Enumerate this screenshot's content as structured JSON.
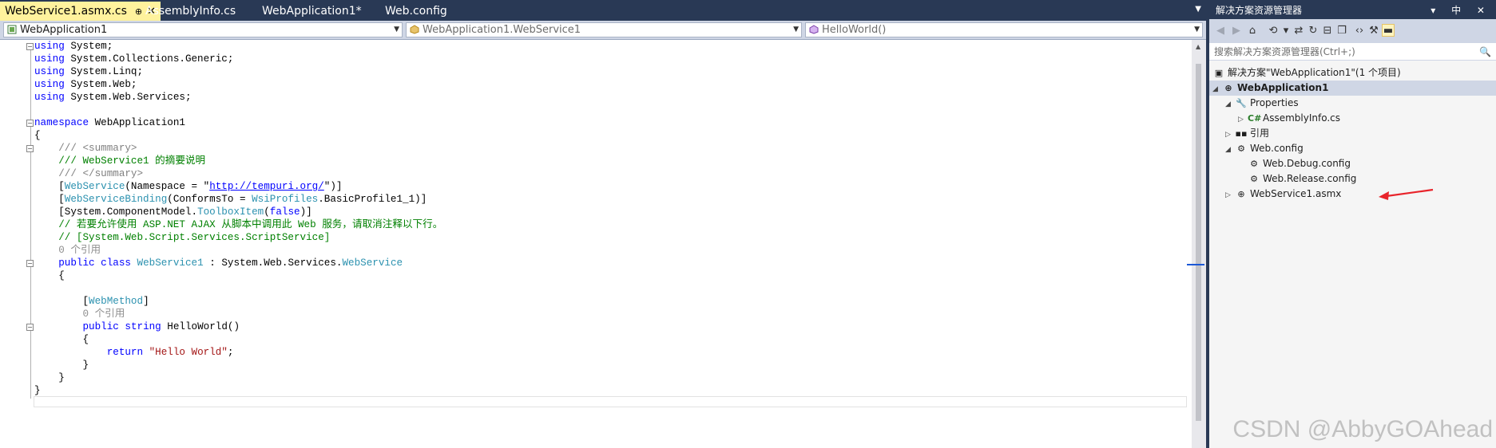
{
  "tabs": [
    {
      "label": "WebService1.asmx.cs",
      "active": true,
      "pin": "⊕",
      "close": "✕"
    },
    {
      "label": "AssemblyInfo.cs",
      "active": false
    },
    {
      "label": "WebApplication1*",
      "active": false
    },
    {
      "label": "Web.config",
      "active": false
    }
  ],
  "navbar": {
    "project": "WebApplication1",
    "class": "WebApplication1.WebService1",
    "member": "HelloWorld()"
  },
  "code": {
    "l1": [
      "using",
      " System;"
    ],
    "l2": [
      "using",
      " System.Collections.Generic;"
    ],
    "l3": [
      "using",
      " System.Linq;"
    ],
    "l4": [
      "using",
      " System.Web;"
    ],
    "l5": [
      "using",
      " System.Web.Services;"
    ],
    "l7": [
      "namespace",
      " WebApplication1"
    ],
    "l8": "{",
    "l9": [
      "    /// ",
      "<summary>"
    ],
    "l10": "    /// WebService1 的摘要说明",
    "l11": [
      "    /// ",
      "</summary>"
    ],
    "l12": [
      "    [",
      "WebService",
      "(Namespace = \"",
      "http://tempuri.org/",
      "\")]"
    ],
    "l13": [
      "    [",
      "WebServiceBinding",
      "(ConformsTo = ",
      "WsiProfiles",
      ".BasicProfile1_1)]"
    ],
    "l14": [
      "    [System.ComponentModel.",
      "ToolboxItem",
      "(",
      "false",
      ")]"
    ],
    "l15": "    // 若要允许使用 ASP.NET AJAX 从脚本中调用此 Web 服务，请取消注释以下行。",
    "l16": "    // [System.Web.Script.Services.ScriptService]",
    "l17": "    0 个引用",
    "l18": [
      "    ",
      "public",
      " ",
      "class",
      " ",
      "WebService1",
      " : System.Web.Services.",
      "WebService"
    ],
    "l19": "    {",
    "l21": [
      "        [",
      "WebMethod",
      "]"
    ],
    "l22": "        0 个引用",
    "l23": [
      "        ",
      "public",
      " ",
      "string",
      " HelloWorld()"
    ],
    "l24": "        {",
    "l25": [
      "            ",
      "return",
      " ",
      "\"Hello World\"",
      ";"
    ],
    "l26": "        }",
    "l27": "    }",
    "l28": "}"
  },
  "solution_explorer": {
    "title": "解决方案资源管理器",
    "title_controls": "▾ 中 ✕",
    "search_placeholder": "搜索解决方案资源管理器(Ctrl+;)",
    "search_icon": "🔍",
    "tree": {
      "solution": "解决方案\"WebApplication1\"(1 个项目)",
      "project": "WebApplication1",
      "properties": "Properties",
      "assemblyinfo": "AssemblyInfo.cs",
      "references": "引用",
      "webconfig": "Web.config",
      "webdebug": "Web.Debug.config",
      "webrelease": "Web.Release.config",
      "webservice": "WebService1.asmx"
    }
  },
  "watermark": "CSDN @AbbyGOAhead",
  "colors": {
    "chrome": "#293955",
    "active_tab": "#fff29d",
    "keyword": "#0000ff",
    "type": "#2b91af",
    "comment": "#008000",
    "annotation_arrow": "#e8242b"
  }
}
